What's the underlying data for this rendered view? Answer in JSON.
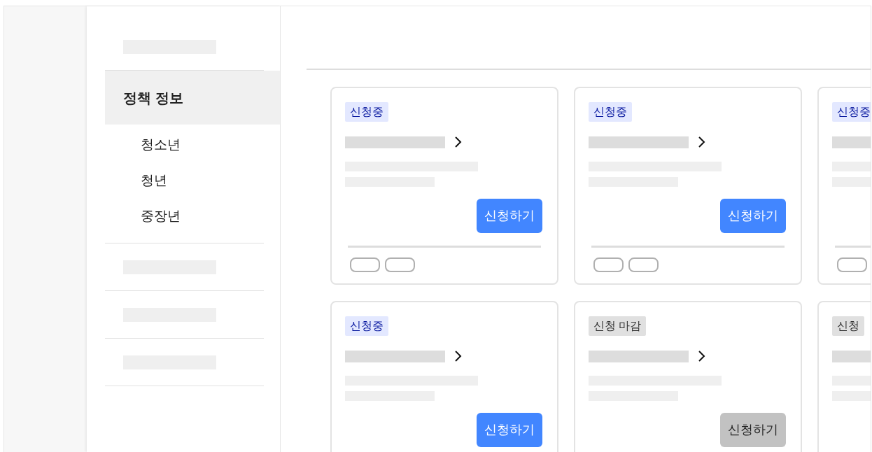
{
  "sidebar": {
    "section": {
      "label": "정책 정보",
      "selected": true
    },
    "items": [
      {
        "label": "청소년"
      },
      {
        "label": "청년"
      },
      {
        "label": "중장년"
      }
    ]
  },
  "cards": [
    {
      "status": "신청중",
      "kind": "open",
      "button": {
        "label": "신청하기",
        "disabled": false
      }
    },
    {
      "status": "신청중",
      "kind": "open",
      "button": {
        "label": "신청하기",
        "disabled": false
      }
    },
    {
      "status": "신청중",
      "kind": "open"
    },
    {
      "status": "신청중",
      "kind": "open",
      "button": {
        "label": "신청하기",
        "disabled": false
      }
    },
    {
      "status": "신청 마감",
      "kind": "closed",
      "button": {
        "label": "신청하기",
        "disabled": true
      }
    },
    {
      "status": "신청",
      "kind": "closed"
    }
  ]
}
